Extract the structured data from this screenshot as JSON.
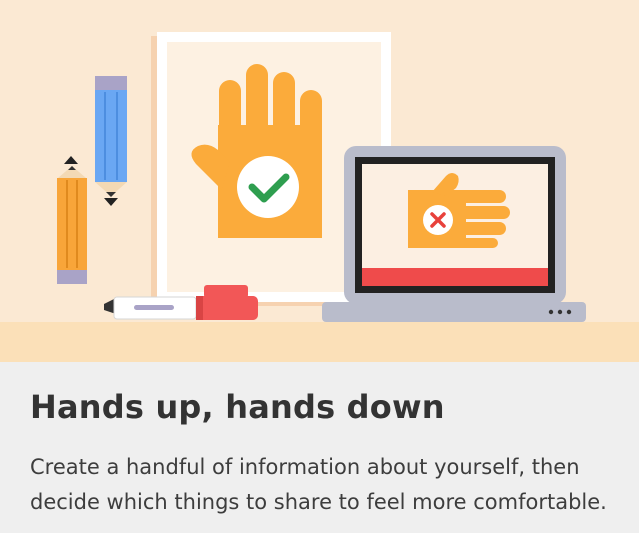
{
  "card": {
    "title": "Hands up, hands down",
    "description": "Create a handful of information about yourself, then decide which things to share to feel more comfortable."
  },
  "colors": {
    "hero_background": "#fbe9d3",
    "desk": "#fbe0b8",
    "body_background": "#efefef",
    "hand": "#fbab3b",
    "check": "#2e9e4f",
    "cross": "#e8413b",
    "laptop_frame": "#b9bccb",
    "pencil_blue": "#6aa7f3",
    "pencil_orange": "#f8a539",
    "marker_red": "#f25757"
  },
  "illustration": {
    "icons": [
      "hand-check-icon",
      "hand-cross-icon",
      "pencil-icon",
      "marker-icon",
      "laptop-icon",
      "arrow-up-icon",
      "arrow-down-icon"
    ]
  }
}
